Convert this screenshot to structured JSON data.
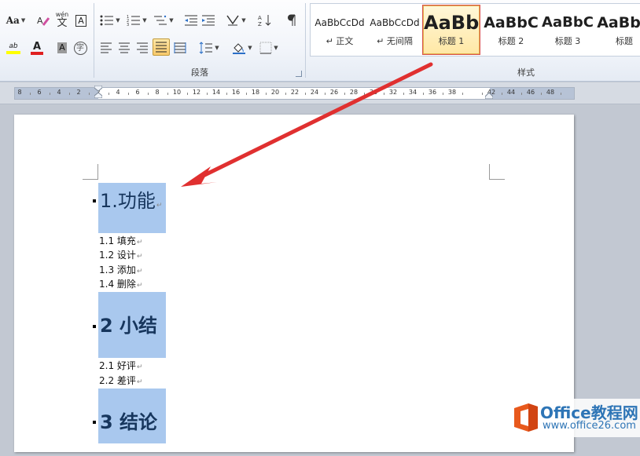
{
  "ribbon": {
    "font_group": {
      "change_case_label": "Aa",
      "phonetic_label": "wén",
      "phonetic_char": "文",
      "char_border_label": "A",
      "char_shading_label": "A",
      "enclosed_char_label": "字",
      "highlight_label": "ab",
      "font_color_label": "A",
      "highlight_color": "#ffff00",
      "font_color": "#e02020"
    },
    "paragraph_group": {
      "label": "段落"
    },
    "styles_group": {
      "label": "样式",
      "items": [
        {
          "preview": "AaBbCcDd",
          "name": "↵ 正文"
        },
        {
          "preview": "AaBbCcDd",
          "name": "↵ 无间隔"
        },
        {
          "preview": "AaBb",
          "name": "标题 1"
        },
        {
          "preview": "AaBbC",
          "name": "标题 2"
        },
        {
          "preview": "AaBbC",
          "name": "标题 3"
        },
        {
          "preview": "AaBbC",
          "name": "标题"
        }
      ]
    }
  },
  "ruler": {
    "ticks": [
      "8",
      "6",
      "4",
      "2",
      "2",
      "4",
      "6",
      "8",
      "10",
      "12",
      "14",
      "16",
      "18",
      "20",
      "22",
      "24",
      "26",
      "28",
      "30",
      "32",
      "34",
      "36",
      "38",
      "",
      "42",
      "44",
      "46",
      "48"
    ]
  },
  "document": {
    "para_mark": "↵",
    "sections": [
      {
        "heading": "1.功能",
        "items": [
          "1.1 填充",
          "1.2 设计",
          "1.3 添加",
          "1.4 删除"
        ]
      },
      {
        "heading": "2 小结",
        "items": [
          "2.1 好评",
          "2.2 差评"
        ]
      },
      {
        "heading": "3 结论",
        "items": []
      }
    ]
  },
  "watermark": {
    "name": "Office教程网",
    "url": "www.office26.com"
  },
  "colors": {
    "heading_highlight": "#a9c8ee",
    "heading_text": "#17365d",
    "arrow": "#e03030"
  }
}
